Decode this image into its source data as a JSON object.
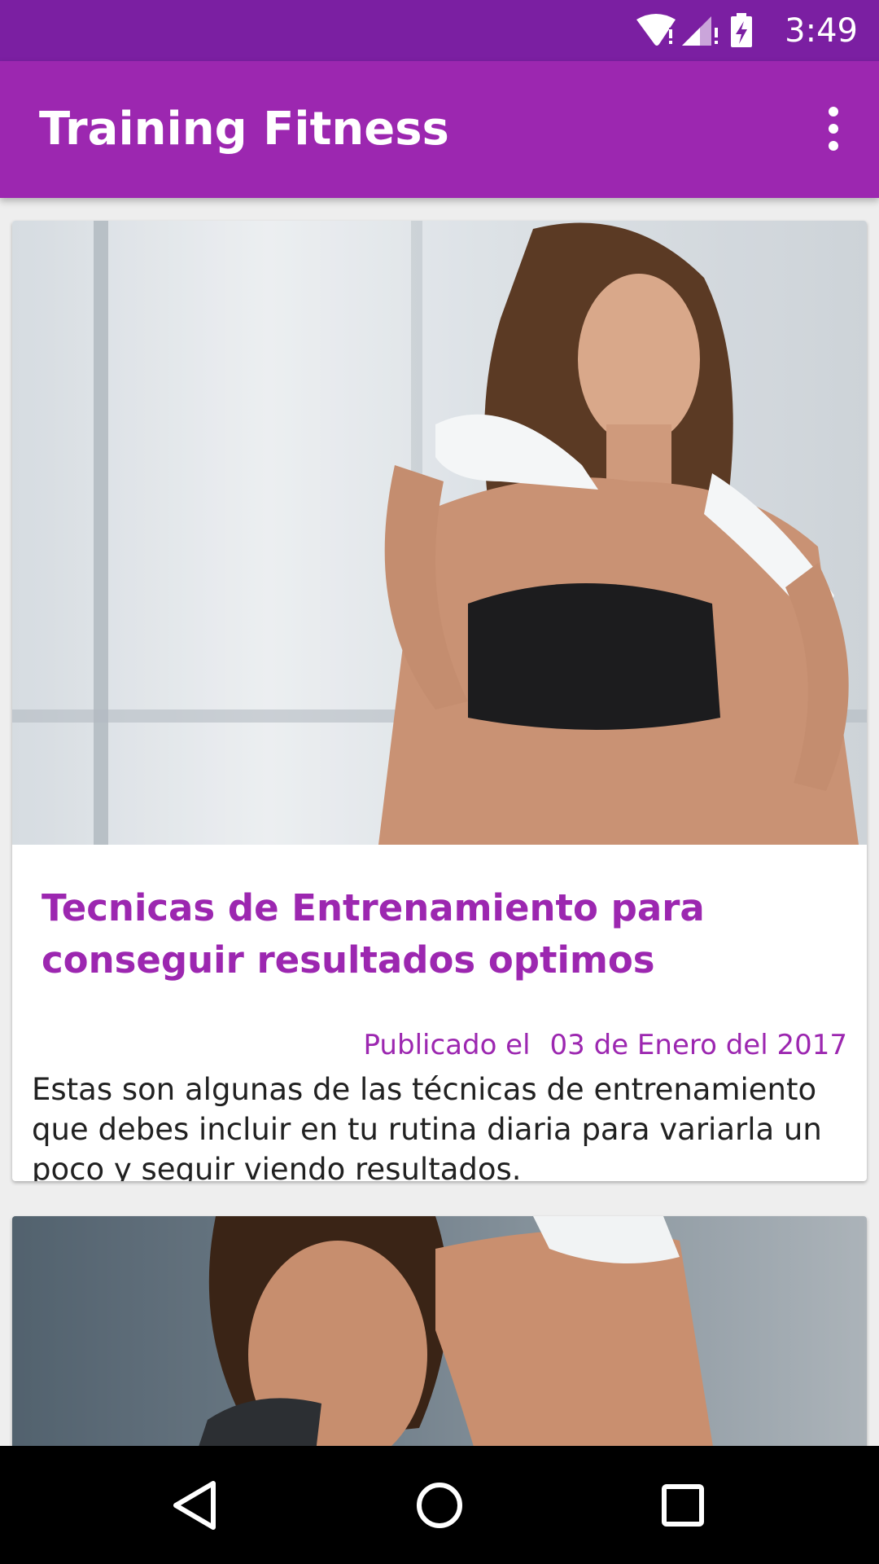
{
  "status_bar": {
    "time": "3:49",
    "icons": [
      "wifi-alert-icon",
      "signal-alert-icon",
      "battery-charging-icon"
    ]
  },
  "app_bar": {
    "title": "Training Fitness",
    "menu_icon": "more-vert-icon"
  },
  "feed": {
    "items": [
      {
        "image": "fitness-photo",
        "title": "Tecnicas de Entrenamiento para conseguir resultados optimos",
        "published_label": "Publicado el",
        "date": "03 de Enero del 2017",
        "description": " Estas son algunas de las técnicas de entrenamiento que debes incluir en tu rutina diaria para variarla un poco y seguir viendo resultados."
      },
      {
        "image": "fitness-photo"
      }
    ]
  },
  "nav_bar": {
    "buttons": [
      "back-icon",
      "home-icon",
      "recents-icon"
    ]
  },
  "colors": {
    "status_bar": "#7b1fa2",
    "app_bar": "#9c27b0",
    "accent": "#9c27b0",
    "background": "#eeeeee"
  }
}
